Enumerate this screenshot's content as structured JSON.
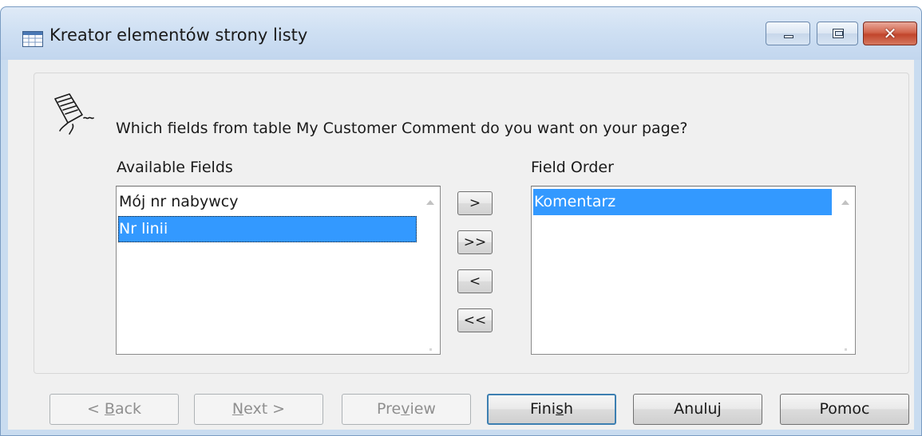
{
  "window": {
    "title": "Kreator elementów strony listy",
    "controls": {
      "minimize": "minimize",
      "maximize": "maximize",
      "close": "close"
    }
  },
  "wizard": {
    "question": "Which fields from table My Customer Comment do you want on your page?",
    "available": {
      "label": "Available Fields",
      "items": [
        {
          "text": "Mój nr nabywcy",
          "selected": false
        },
        {
          "text": "Nr linii",
          "selected": true
        }
      ]
    },
    "order": {
      "label": "Field Order",
      "items": [
        {
          "text": "Komentarz",
          "selected": true
        }
      ]
    },
    "movers": {
      "add": ">",
      "add_all": ">>",
      "remove": "<",
      "remove_all": "<<"
    }
  },
  "footer": {
    "back": {
      "pre": "< ",
      "mn": "B",
      "post": "ack",
      "enabled": false
    },
    "next": {
      "pre": "",
      "mn": "N",
      "post": "ext >",
      "enabled": false
    },
    "preview": {
      "pre": "Pre",
      "mn": "v",
      "post": "iew",
      "enabled": false
    },
    "finish": {
      "pre": "Fini",
      "mn": "s",
      "post": "h",
      "enabled": true
    },
    "cancel": {
      "label": "Anuluj",
      "enabled": true
    },
    "help": {
      "label": "Pomoc",
      "enabled": true
    }
  },
  "colors": {
    "selection": "#3399ff",
    "titlebar": "#cfe0f3",
    "dialog_face": "#f0f0f0",
    "close_button": "#c1452c",
    "default_button_border": "#3c7fb1"
  },
  "icons": [
    "table-icon",
    "wizard-pen-icon",
    "minimize-icon",
    "maximize-icon",
    "close-icon",
    "scroll-up-icon",
    "scroll-down-icon"
  ]
}
